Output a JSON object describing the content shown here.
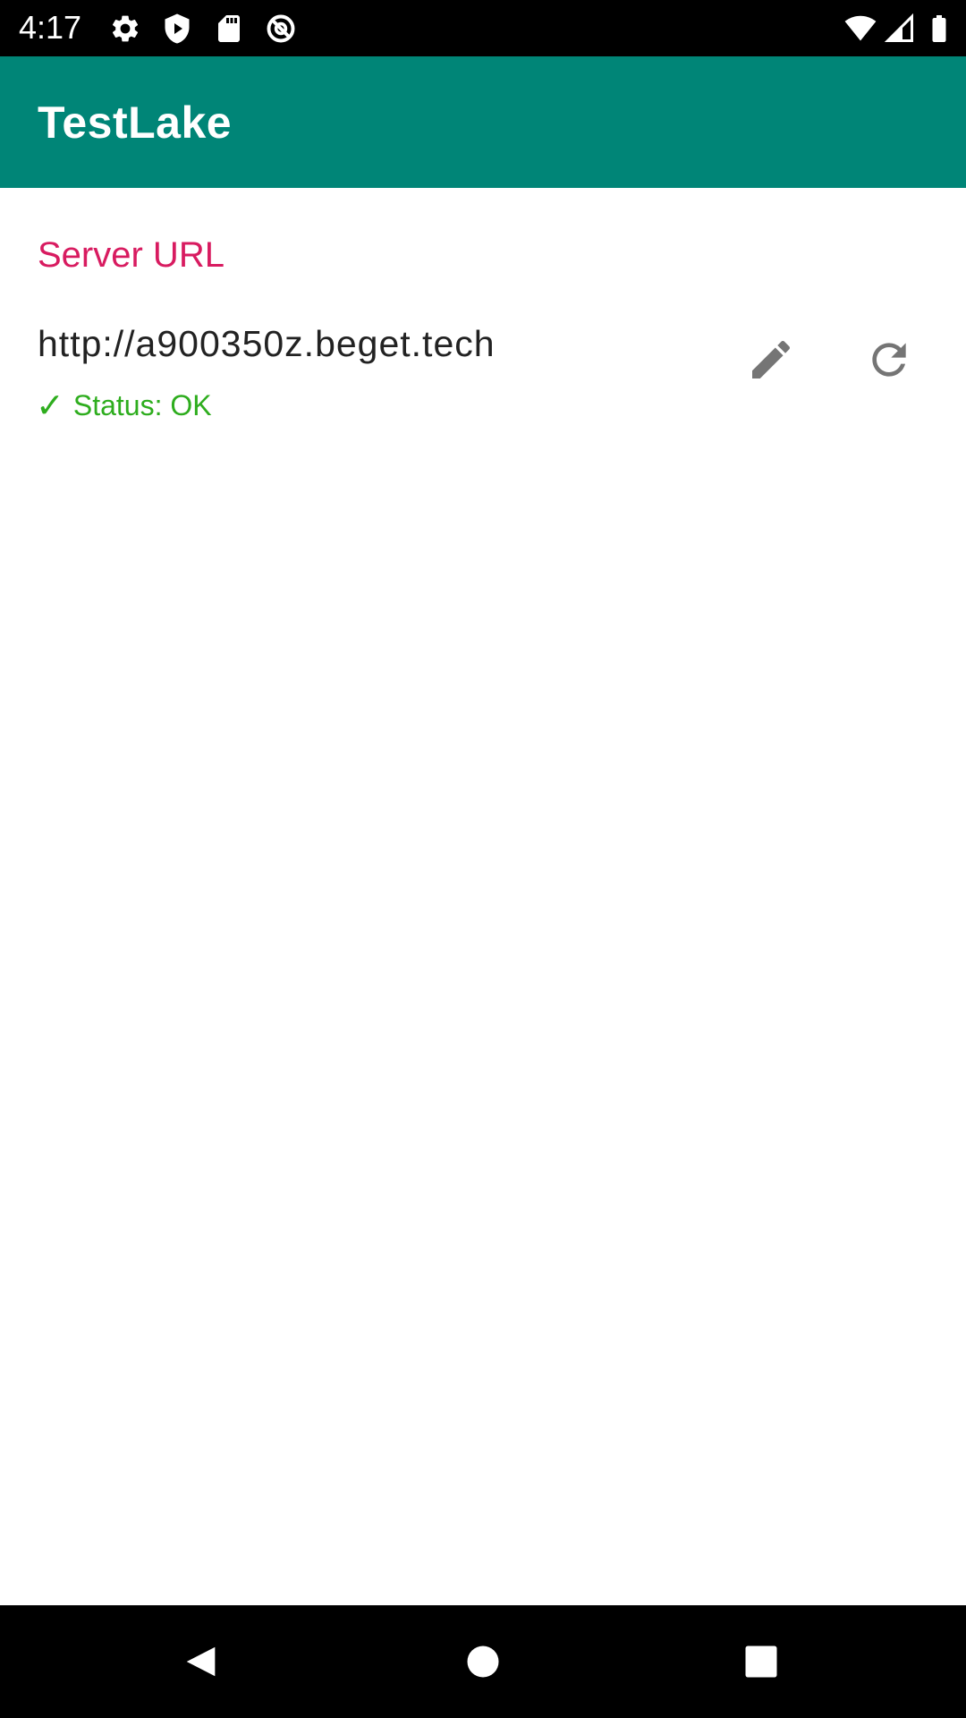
{
  "status_bar": {
    "time": "4:17",
    "left_icons": [
      "settings-icon",
      "shield-play-icon",
      "sd-card-icon",
      "no-disturb-icon"
    ],
    "right_icons": [
      "wifi-icon",
      "cell-signal-icon",
      "battery-icon"
    ],
    "icon_color": "#ffffff"
  },
  "app_bar": {
    "title": "TestLake",
    "background_color": "#008577"
  },
  "main": {
    "section_title": "Server URL",
    "section_title_color": "#D81B60",
    "server_url": "http://a900350z.beget.tech",
    "status_check": "✓",
    "status_text": "Status: OK",
    "status_color": "#2EAD1E",
    "actions": [
      {
        "icon": "pencil-icon",
        "name": "edit"
      },
      {
        "icon": "refresh-icon",
        "name": "refresh"
      }
    ],
    "action_icon_color": "#757575"
  },
  "nav_bar": {
    "buttons": [
      "back-icon",
      "home-icon",
      "recents-icon"
    ]
  }
}
